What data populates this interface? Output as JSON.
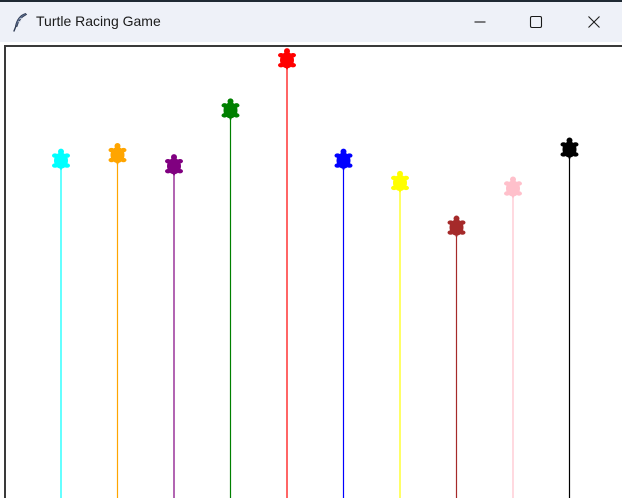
{
  "window": {
    "title": "Turtle Racing Game",
    "icon": "feather-icon",
    "controls": [
      "minimize-icon",
      "maximize-icon",
      "close-icon"
    ]
  },
  "turtles": [
    {
      "color": "#00ffff",
      "progress": 0.8
    },
    {
      "color": "#ffa500",
      "progress": 0.81
    },
    {
      "color": "#800080",
      "progress": 0.79
    },
    {
      "color": "#008000",
      "progress": 0.89
    },
    {
      "color": "#ff0000",
      "progress": 0.98
    },
    {
      "color": "#0000ff",
      "progress": 0.8
    },
    {
      "color": "#ffff00",
      "progress": 0.76
    },
    {
      "color": "#a52a2a",
      "progress": 0.68
    },
    {
      "color": "#ffc0cb",
      "progress": 0.75
    },
    {
      "color": "#000000",
      "progress": 0.82
    }
  ]
}
